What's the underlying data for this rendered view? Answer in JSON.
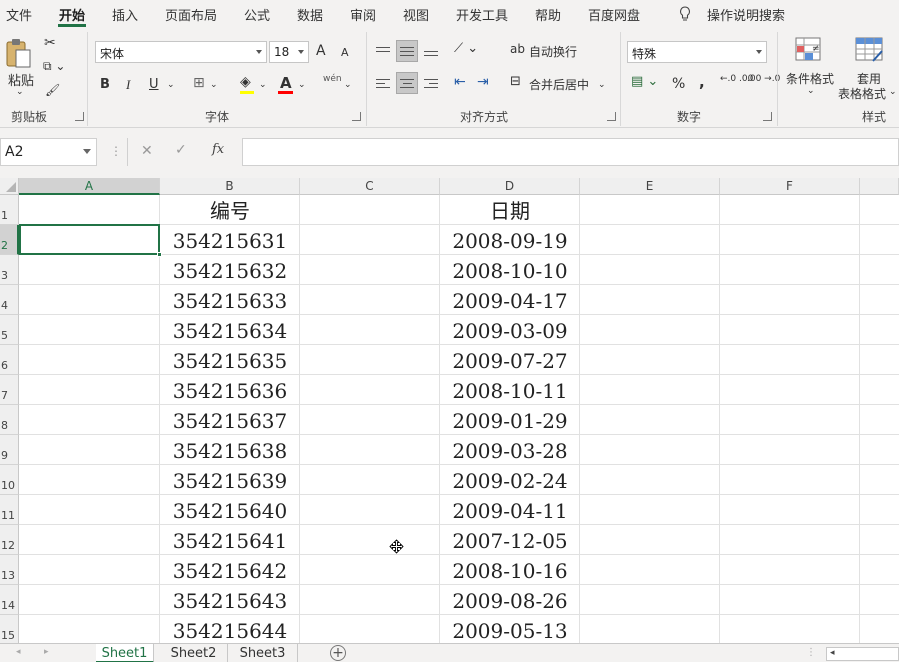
{
  "menu_tabs": [
    "文件",
    "开始",
    "插入",
    "页面布局",
    "公式",
    "数据",
    "审阅",
    "视图",
    "开发工具",
    "帮助",
    "百度网盘"
  ],
  "active_tab": "开始",
  "tell_me": "操作说明搜索",
  "ribbon": {
    "clipboard": {
      "paste": "粘贴",
      "label": "剪贴板"
    },
    "font": {
      "name": "宋体",
      "size": "18",
      "bold": "B",
      "italic": "I",
      "underline": "U",
      "grow": "A",
      "shrink": "A",
      "font_color": "A",
      "phonetic": "wén",
      "label": "字体"
    },
    "alignment": {
      "wrap": "自动换行",
      "merge": "合并后居中",
      "label": "对齐方式"
    },
    "number": {
      "format": "特殊",
      "percent": "%",
      "comma": ",",
      "inc": "←.0 .00",
      "dec": ".00 →.0",
      "label": "数字"
    },
    "styles": {
      "conditional": "条件格式",
      "table_format_1": "套用",
      "table_format_2": "表格格式",
      "label": "样式"
    }
  },
  "formula_bar": {
    "name_box": "A2",
    "cancel": "✕",
    "enter": "✓",
    "fx": "fx",
    "value": ""
  },
  "columns": [
    "A",
    "B",
    "C",
    "D",
    "E",
    "F"
  ],
  "selected_column": "A",
  "rows": [
    "1",
    "2",
    "3",
    "4",
    "5",
    "6",
    "7",
    "8",
    "9",
    "10",
    "11",
    "12",
    "13",
    "14",
    "15"
  ],
  "selected_row": "2",
  "table": {
    "header_b": "编号",
    "header_d": "日期",
    "records": [
      {
        "id": "354215631",
        "date": "2008-09-19"
      },
      {
        "id": "354215632",
        "date": "2008-10-10"
      },
      {
        "id": "354215633",
        "date": "2009-04-17"
      },
      {
        "id": "354215634",
        "date": "2009-03-09"
      },
      {
        "id": "354215635",
        "date": "2009-07-27"
      },
      {
        "id": "354215636",
        "date": "2008-10-11"
      },
      {
        "id": "354215637",
        "date": "2009-01-29"
      },
      {
        "id": "354215638",
        "date": "2009-03-28"
      },
      {
        "id": "354215639",
        "date": "2009-02-24"
      },
      {
        "id": "354215640",
        "date": "2009-04-11"
      },
      {
        "id": "354215641",
        "date": "2007-12-05"
      },
      {
        "id": "354215642",
        "date": "2008-10-16"
      },
      {
        "id": "354215643",
        "date": "2009-08-26"
      },
      {
        "id": "354215644",
        "date": "2009-05-13"
      }
    ]
  },
  "sheets": [
    "Sheet1",
    "Sheet2",
    "Sheet3"
  ],
  "active_sheet": "Sheet1",
  "colors": {
    "accent": "#217346",
    "ribbon_bg": "#f3f2f1",
    "grid_line": "#e1e1e1"
  }
}
